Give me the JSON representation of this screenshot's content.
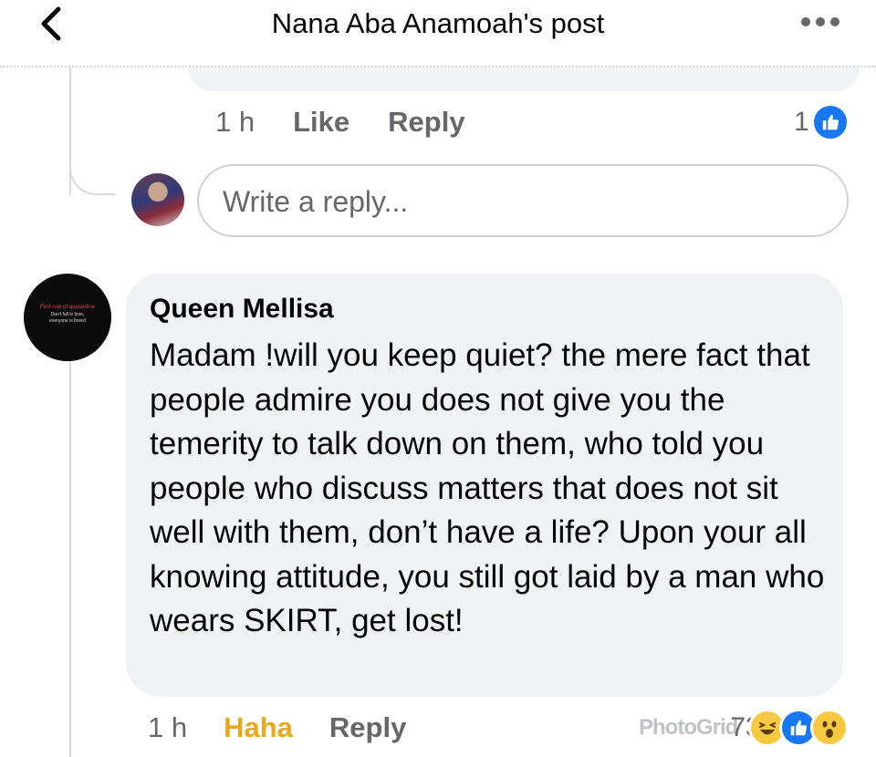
{
  "header": {
    "title": "Nana Aba Anamoah's post",
    "back_icon": "chevron-left-icon",
    "more_icon": "more-horizontal-icon"
  },
  "previous_reply": {
    "time": "1 h",
    "like_label": "Like",
    "reply_label": "Reply",
    "reaction_count": "1"
  },
  "reply_box": {
    "placeholder": "Write a reply..."
  },
  "comment": {
    "avatar_text": {
      "line1": "First rule of quarantine",
      "line2": "Don't fall in love,",
      "line3": "everyone is bored"
    },
    "author": "Queen Mellisa",
    "text": "Madam !will you keep quiet? the mere fact that people admire you does not give you the temerity to talk down on them, who told you people who discuss matters that does not sit well with them, don’t have a life? Upon your all knowing  attitude, you still got laid by a man who wears SKIRT, get lost!",
    "time": "1 h",
    "reaction_label": "Haha",
    "reply_label": "Reply",
    "reaction_count": "73",
    "watermark": "PhotoGrid"
  },
  "colors": {
    "like_blue": "#1877f2",
    "haha_yellow": "#e9a81d",
    "bubble_gray": "#f0f2f5",
    "secondary_text": "#65676b"
  }
}
